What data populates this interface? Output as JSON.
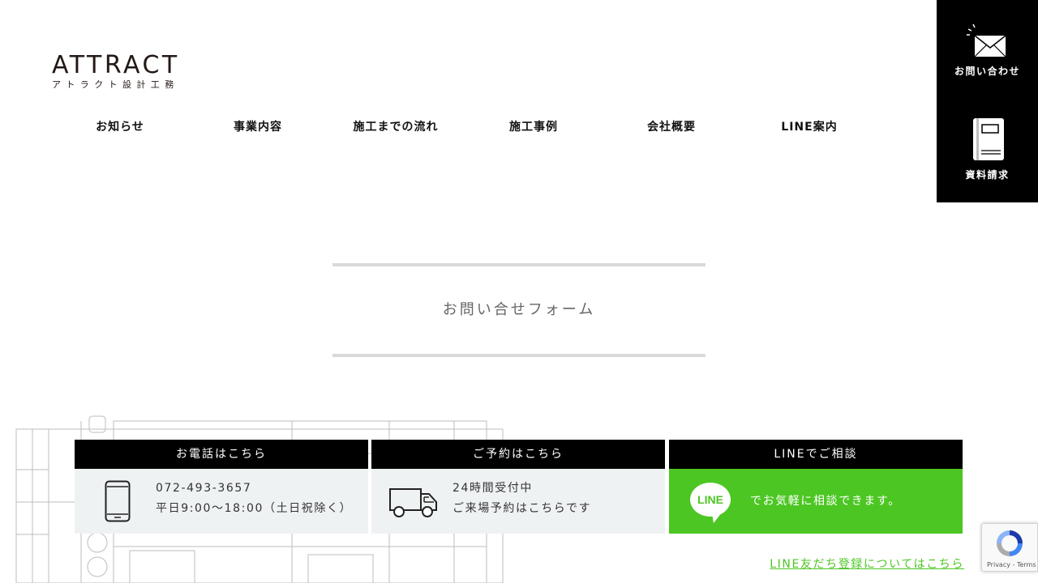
{
  "logo": {
    "main": "ATTRACT",
    "sub": "アトラクト設計工務"
  },
  "nav": [
    {
      "label": "お知らせ"
    },
    {
      "label": "事業内容"
    },
    {
      "label": "施工までの流れ"
    },
    {
      "label": "施工事例"
    },
    {
      "label": "会社概要"
    },
    {
      "label": "LINE案内"
    }
  ],
  "side": {
    "contact_label": "お問い合わせ",
    "contact_icon": "mail-icon",
    "docs_label": "資料請求",
    "docs_icon": "book-icon"
  },
  "section": {
    "title": "お問い合せフォーム"
  },
  "cta": {
    "phone": {
      "heading": "お電話はこちら",
      "number": "072-493-3657",
      "hours": "平日9:00～18:00（土日祝除く）",
      "icon": "smartphone-icon"
    },
    "reserve": {
      "heading": "ご予約はこちら",
      "line1": "24時間受付中",
      "line2": "ご来場予約はこちらです",
      "icon": "van-icon"
    },
    "line": {
      "heading": "LINEでご相談",
      "text": "でお気軽に相談できます。",
      "icon_label": "LINE",
      "icon": "line-logo-icon"
    }
  },
  "line_link": "LINE友だち登録についてはこちら",
  "recaptcha": {
    "text": "Privacy - Terms"
  },
  "colors": {
    "line_green": "#4cc623",
    "black": "#000000",
    "light_bg": "#eff2f3"
  }
}
